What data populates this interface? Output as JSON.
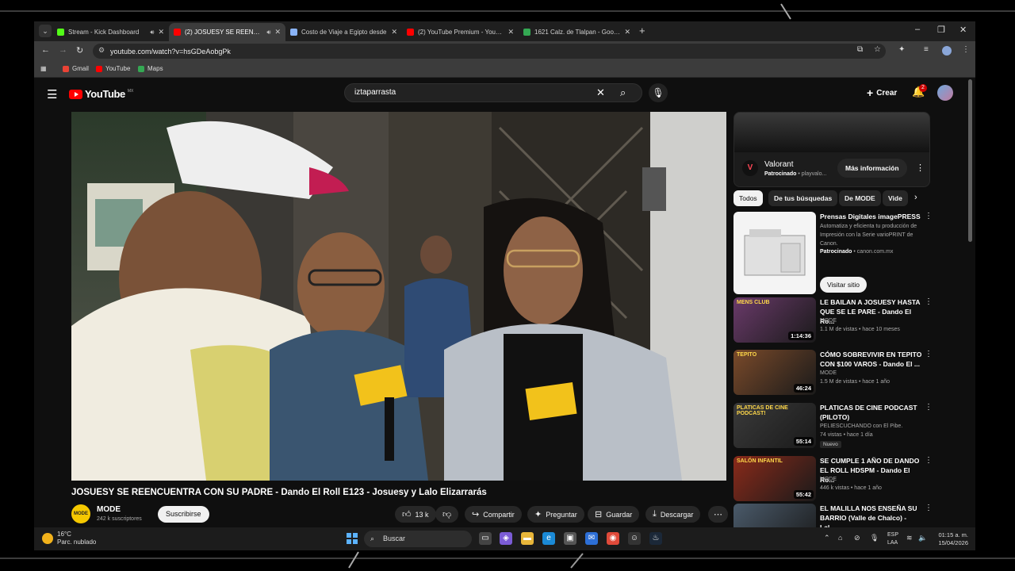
{
  "browser": {
    "tabs": [
      {
        "title": "Stream - Kick Dashboard",
        "favicon_color": "#53fc18",
        "audio": true
      },
      {
        "title": "(2) JOSUESY SE REENCUENTRA",
        "favicon_color": "#ff0000",
        "audio": true,
        "active": true
      },
      {
        "title": "Costo de Viaje a Egipto desde",
        "favicon_color": "#8ab4f8",
        "audio": false
      },
      {
        "title": "(2) YouTube Premium - YouTube",
        "favicon_color": "#ff0000",
        "audio": false
      },
      {
        "title": "1621 Calz. de Tlalpan - Google",
        "favicon_color": "#34a853",
        "audio": false
      }
    ],
    "url": "youtube.com/watch?v=hsGDeAobgPk",
    "bookmarks": [
      {
        "label": "Gmail",
        "color": "#ea4335"
      },
      {
        "label": "YouTube",
        "color": "#ff0000"
      },
      {
        "label": "Maps",
        "color": "#34a853"
      }
    ]
  },
  "youtube": {
    "logo_text": "YouTube",
    "country_code": "MX",
    "search_query": "iztaparrasta",
    "create_label": "Crear",
    "notification_count": "2",
    "video": {
      "title": "JOSUESY SE REENCUENTRA CON SU PADRE - Dando El Roll E123 - Josuesy y Lalo Elizarrarás",
      "channel": "MODE",
      "subscribers": "242 k suscriptores",
      "subscribe_label": "Suscribirse",
      "likes": "13 k",
      "share_label": "Compartir",
      "ask_label": "Preguntar",
      "save_label": "Guardar",
      "download_label": "Descargar"
    },
    "ad": {
      "name": "Valorant",
      "sponsored": "Patrocinado",
      "domain": "playvalo...",
      "cta": "Más información"
    },
    "chips": [
      "Todos",
      "De tus búsquedas",
      "De MODE",
      "Vide"
    ],
    "ad_card": {
      "title": "Prensas Digitales imagePRESS",
      "description": "Automatiza y eficienta tu producción de Impresión con la Serie varioPRINT de Canon.",
      "sponsored": "Patrocinado",
      "domain": "canon.com.mx",
      "cta": "Visitar sitio"
    },
    "related": [
      {
        "title": "LE BAILAN A JOSUESY HASTA QUE SE LE PARE - Dando El Ro...",
        "channel": "MODE",
        "meta": "1.1 M de vistas • hace 10 meses",
        "duration": "1:14:36",
        "thumb_label": "MENS CLUB"
      },
      {
        "title": "CÓMO SOBREVIVIR EN TEPITO CON $100 VAROS - Dando El ...",
        "channel": "MODE",
        "meta": "1.5 M de vistas • hace 1 año",
        "duration": "46:24",
        "thumb_label": "TEPITO"
      },
      {
        "title": "PLATICAS DE CINE PODCAST (PILOTO)",
        "channel": "PELIESCUCHANDO con El Pibe.",
        "meta": "74 vistas • hace 1 día",
        "duration": "55:14",
        "badge": "Nuevo",
        "thumb_label": "PLATICAS DE CINE PODCAST!"
      },
      {
        "title": "SE CUMPLE 1 AÑO DE DANDO EL ROLL HDSPM - Dando El Ro...",
        "channel": "MODE",
        "meta": "446 k vistas • hace 1 año",
        "duration": "55:42",
        "thumb_label": "SALÓN INFANTIL"
      },
      {
        "title": "EL MALILLA NOS ENSEÑA SU BARRIO (Valle de Chalco) - Lal...",
        "channel": "",
        "meta": "",
        "duration": "",
        "thumb_label": ""
      }
    ]
  },
  "taskbar": {
    "temperature": "16°C",
    "weather": "Parc. nublado",
    "search_label": "Buscar",
    "lang_top": "ESP",
    "lang_bottom": "LAA",
    "time": "01:15 a. m.",
    "date": "15/04/2026"
  },
  "colors": {
    "youtube_red": "#ff0000",
    "background": "#0f0f0f",
    "chip": "#272727"
  }
}
